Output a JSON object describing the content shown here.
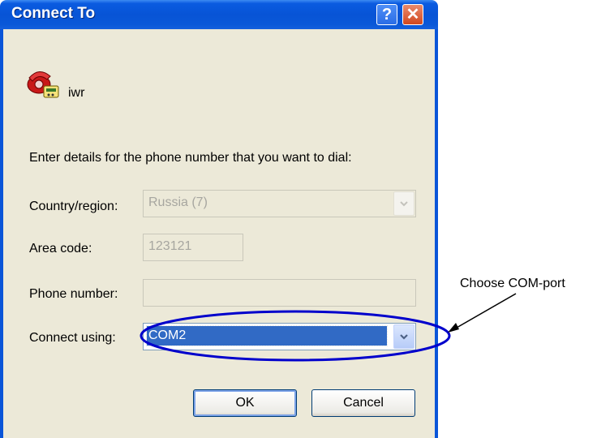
{
  "window": {
    "title": "Connect To",
    "help_glyph": "?",
    "close_glyph": "✕"
  },
  "connection": {
    "name": "iwr",
    "icon": "phone-connection-icon"
  },
  "prompt": "Enter details for the phone number that you want to dial:",
  "fields": {
    "country": {
      "label": "Country/region:",
      "value": "Russia (7)",
      "enabled": false
    },
    "area_code": {
      "label": "Area code:",
      "value": "123121",
      "enabled": false
    },
    "phone_number": {
      "label": "Phone number:",
      "value": "",
      "enabled": false
    },
    "connect_using": {
      "label": "Connect using:",
      "value": "COM2",
      "enabled": true
    }
  },
  "buttons": {
    "ok": "OK",
    "cancel": "Cancel"
  },
  "annotation": {
    "text": "Choose COM-port",
    "color": "#0000cc"
  }
}
